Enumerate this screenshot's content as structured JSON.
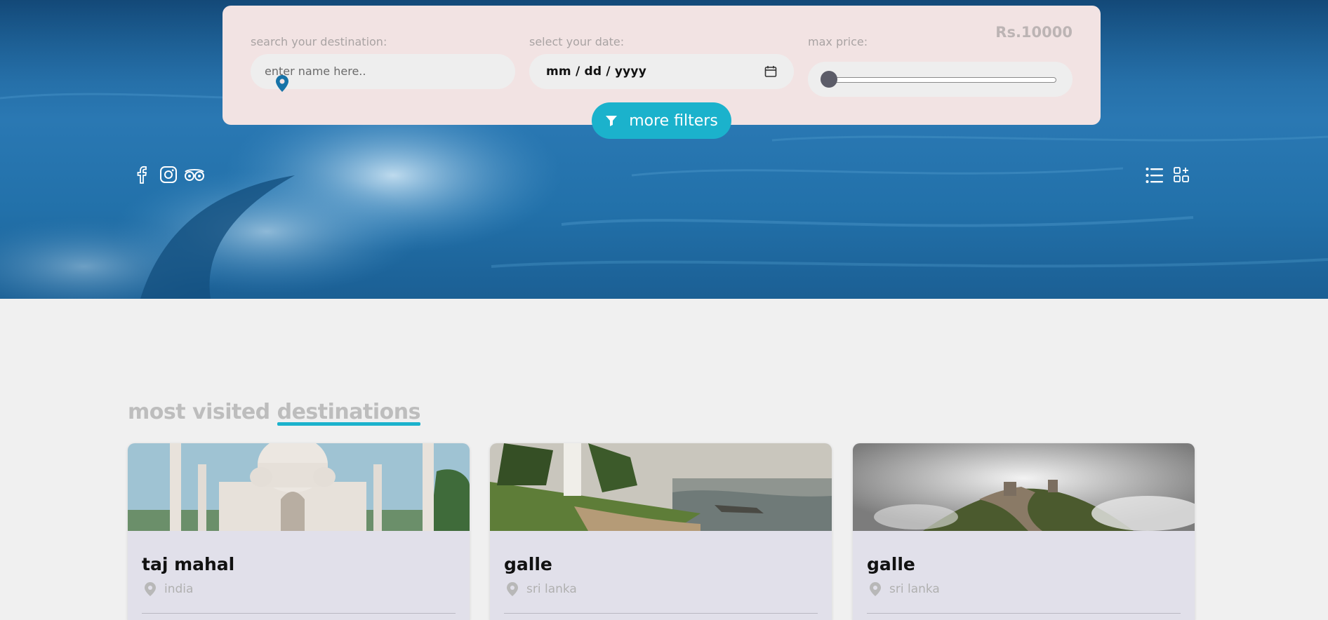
{
  "search": {
    "label": "search your destination:",
    "placeholder": "enter name here.."
  },
  "date": {
    "label": "select your date:",
    "placeholder": "mm / dd / yyyy"
  },
  "price": {
    "label": "max price:",
    "value": "Rs.10000",
    "slider_fraction": 0.0
  },
  "more_filters": {
    "label": "more filters"
  },
  "social_icons": [
    "facebook-icon",
    "instagram-icon",
    "tripadvisor-icon"
  ],
  "view_icons": [
    "list-view-icon",
    "grid-view-icon"
  ],
  "section": {
    "title_plain": "most visited ",
    "title_accent": "destinations",
    "accent_color": "#1bb2cc"
  },
  "cards": [
    {
      "name": "taj mahal",
      "location": "india"
    },
    {
      "name": "galle",
      "location": "sri lanka"
    },
    {
      "name": "galle",
      "location": "sri lanka"
    }
  ],
  "colors": {
    "hero_blue": "#2271aa",
    "panel": "#f2e3e3",
    "button": "#1bb2cc",
    "pin": "#1673a8"
  }
}
